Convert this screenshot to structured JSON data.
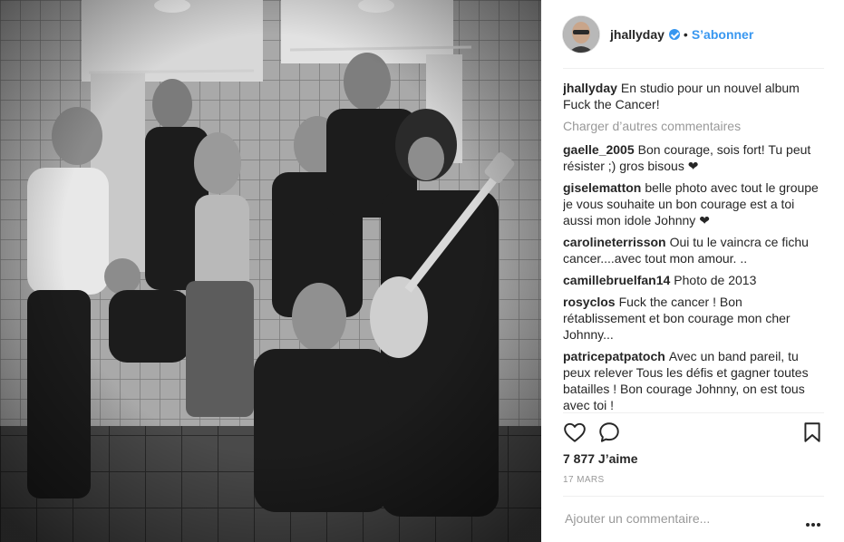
{
  "post": {
    "username": "jhallyday",
    "follow_label": "S’abonner",
    "dot": "•",
    "caption": "En studio pour un nouvel album Fuck the Cancer!",
    "load_more": "Charger d’autres commentaires",
    "comments": [
      {
        "user": "gaelle_2005",
        "text": "Bon courage, sois fort! Tu peut résister ;) gros bisous ❤"
      },
      {
        "user": "giselematton",
        "text": "belle photo avec tout le groupe je vous souhaite un bon courage est a toi aussi mon idole Johnny ❤"
      },
      {
        "user": "carolineterrisson",
        "text": "Oui tu le vaincra ce fichu cancer....avec tout mon amour. .."
      },
      {
        "user": "camillebruelfan14",
        "text": "Photo de 2013"
      },
      {
        "user": "rosyclos",
        "text": "Fuck the cancer ! Bon rétablissement et bon courage mon cher Johnny..."
      },
      {
        "user": "patricepatpatoch",
        "text": "Avec un band pareil, tu peux relever Tous les défis et gagner toutes batailles ! Bon courage Johnny, on est tous avec toi !"
      }
    ],
    "likes": "7 877 J’aime",
    "date": "17 MARS",
    "add_comment_placeholder": "Ajouter un commentaire...",
    "icons": {
      "like": "heart-icon",
      "comment": "comment-bubble-icon",
      "save": "bookmark-icon",
      "more": "more-options-icon",
      "verified": "verified-badge-icon"
    },
    "colors": {
      "accent": "#3897f0",
      "text": "#262626",
      "muted": "#999999",
      "divider": "#efefef"
    }
  }
}
